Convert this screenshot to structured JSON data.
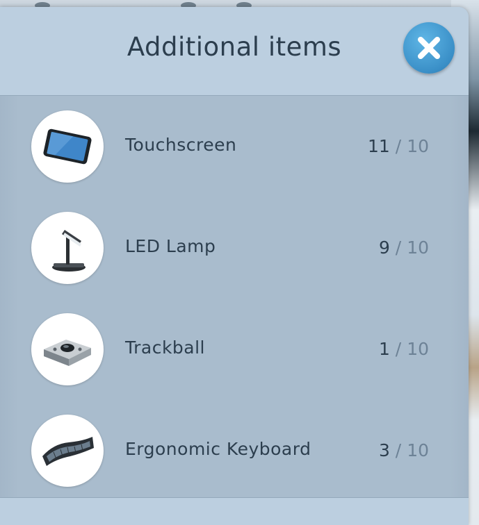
{
  "modal": {
    "title": "Additional items",
    "close_icon": "close-x-icon"
  },
  "items": [
    {
      "name": "Touchscreen",
      "count": "11",
      "separator": "/",
      "max": "10",
      "icon": "touchscreen-icon"
    },
    {
      "name": "LED Lamp",
      "count": "9",
      "separator": "/",
      "max": "10",
      "icon": "led-lamp-icon"
    },
    {
      "name": "Trackball",
      "count": "1",
      "separator": "/",
      "max": "10",
      "icon": "trackball-icon"
    },
    {
      "name": "Ergonomic Keyboard",
      "count": "3",
      "separator": "/",
      "max": "10",
      "icon": "ergonomic-keyboard-icon"
    }
  ],
  "colors": {
    "panel": "#a9bccd",
    "header": "#bccfe0",
    "text": "#2c3e4e",
    "close_button": "#3a8fc7"
  }
}
